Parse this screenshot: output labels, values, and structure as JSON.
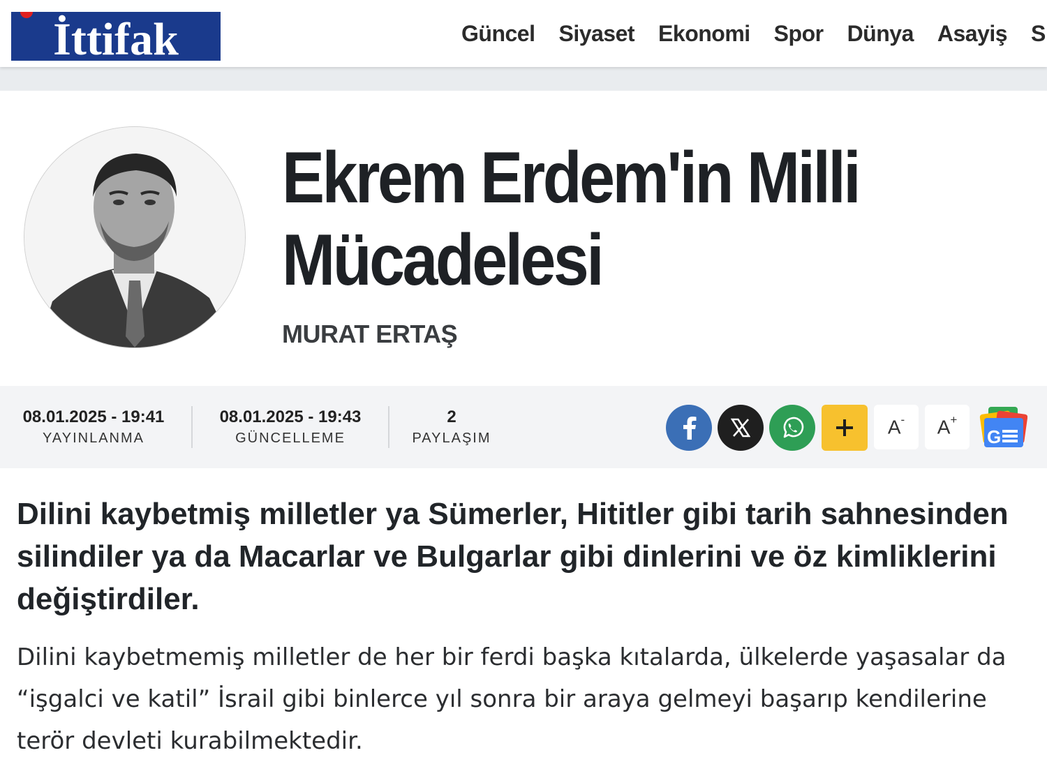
{
  "site": {
    "logo_text": "İttifak",
    "brand_color": "#1a3a8c",
    "logo_dot_color": "#e02020"
  },
  "nav": {
    "items": [
      "Güncel",
      "Siyaset",
      "Ekonomi",
      "Spor",
      "Dünya",
      "Asayiş",
      "S"
    ]
  },
  "article": {
    "title": "Ekrem Erdem'in Milli Mücadelesi",
    "author": "MURAT ERTAŞ",
    "lead": "Dilini kaybetmiş milletler ya Sümerler, Hititler gibi tarih sahnesinden silindiler ya da Macarlar ve Bulgarlar gibi dinlerini ve öz kimliklerini değiştirdiler.",
    "paragraph": "Dilini kaybetmemiş milletler de her bir ferdi başka kıtalarda, ülkelerde yaşasalar da “işgalci ve katil” İsrail gibi binlerce yıl sonra bir araya gelmeyi başarıp kendilerine terör devleti kurabilmektedir."
  },
  "meta": {
    "published_value": "08.01.2025 - 19:41",
    "published_label": "YAYINLANMA",
    "updated_value": "08.01.2025 - 19:43",
    "updated_label": "GÜNCELLEME",
    "shares_value": "2",
    "shares_label": "PAYLAŞIM"
  },
  "share": {
    "facebook_color": "#3b6fb6",
    "x_color": "#1f1f1f",
    "whatsapp_color": "#2e9e55",
    "more_color": "#f7c12e",
    "icons": [
      "facebook-icon",
      "x-icon",
      "whatsapp-icon",
      "plus-icon",
      "google-news-icon"
    ],
    "font_decrease": "A",
    "font_decrease_sup": "-",
    "font_increase": "A",
    "font_increase_sup": "+"
  }
}
